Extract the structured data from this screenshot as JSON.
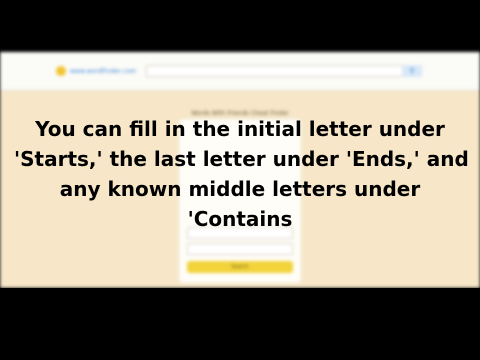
{
  "website": {
    "logo_text": "www.wordfinder.com",
    "search_placeholder": "",
    "search_button_icon": "search-icon",
    "page_heading": "Words With Friends Cheat Finder",
    "form": {
      "field1_placeholder": "",
      "field2_placeholder": "",
      "submit_label": "Search"
    }
  },
  "caption": {
    "lines": [
      "You can fill in the initial letter under",
      "'Starts,' the last letter under 'Ends,' and",
      "any known middle letters under",
      "'Contains"
    ]
  },
  "colors": {
    "page_background": "#f7e7c8",
    "header_background": "#fbfbf7",
    "accent_yellow": "#f2d33a",
    "link_blue": "#2f7dd8",
    "letterbox": "#000000"
  }
}
